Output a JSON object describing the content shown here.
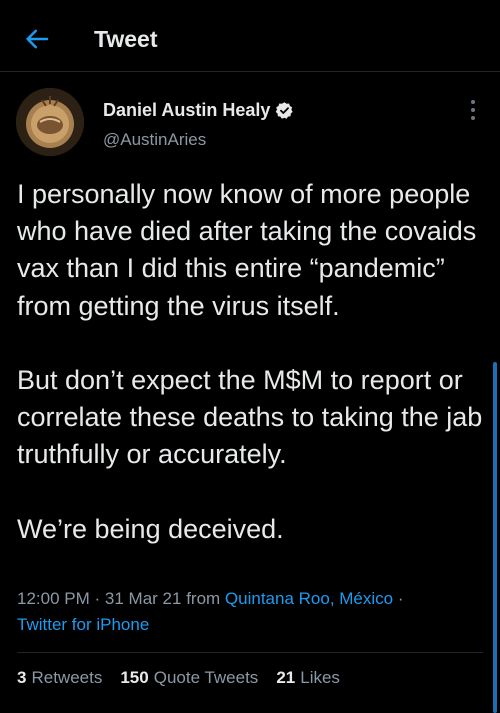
{
  "header": {
    "title": "Tweet",
    "back_icon": "arrow-left-icon"
  },
  "tweet": {
    "author": {
      "display_name": "Daniel Austin Healy",
      "handle": "@AustinAries",
      "verified_icon": "verified-badge-icon"
    },
    "text": "I personally now know of more people who have died after taking the covaids vax than I did this entire “pandemic” from getting the virus itself.\n\nBut don’t expect the M$M to report or correlate these deaths to taking the jab truthfully or accurately.\n\nWe’re being deceived.",
    "time": "12:00 PM",
    "separator": "·",
    "date": "31 Mar 21",
    "from_label": "from",
    "location": "Quintana Roo, México",
    "source": "Twitter for iPhone"
  },
  "stats": {
    "retweets_count": "3",
    "retweets_label": "Retweets",
    "quotes_count": "150",
    "quotes_label": "Quote Tweets",
    "likes_count": "21",
    "likes_label": "Likes"
  },
  "colors": {
    "background": "#000000",
    "text_primary": "#e7e9ea",
    "text_secondary": "#8b98a5",
    "link": "#1d9bf0",
    "divider": "#202327"
  }
}
